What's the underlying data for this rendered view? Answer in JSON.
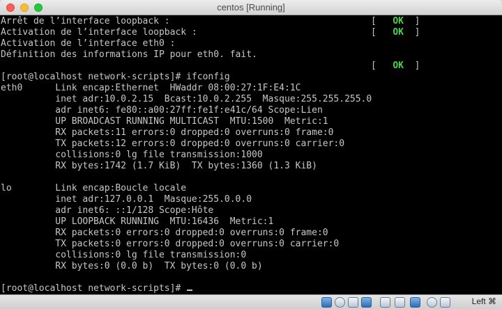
{
  "window": {
    "title": "centos [Running]"
  },
  "terminal": {
    "lines": [
      "Arrêt de l’interface loopback :",
      "Activation de l’interface loopback :",
      "Activation de l’interface eth0 :",
      "Définition des informations IP pour eth0. fait.",
      "",
      "[root@localhost network-scripts]# ifconfig",
      "eth0      Link encap:Ethernet  HWaddr 08:00:27:1F:E4:1C",
      "          inet adr:10.0.2.15  Bcast:10.0.2.255  Masque:255.255.255.0",
      "          adr inet6: fe80::a00:27ff:fe1f:e41c/64 Scope:Lien",
      "          UP BROADCAST RUNNING MULTICAST  MTU:1500  Metric:1",
      "          RX packets:11 errors:0 dropped:0 overruns:0 frame:0",
      "          TX packets:12 errors:0 dropped:0 overruns:0 carrier:0",
      "          collisions:0 lg file transmission:1000",
      "          RX bytes:1742 (1.7 KiB)  TX bytes:1360 (1.3 KiB)",
      "",
      "lo        Link encap:Boucle locale",
      "          inet adr:127.0.0.1  Masque:255.0.0.0",
      "          adr inet6: ::1/128 Scope:Hôte",
      "          UP LOOPBACK RUNNING  MTU:16436  Metric:1",
      "          RX packets:0 errors:0 dropped:0 overruns:0 frame:0",
      "          TX packets:0 errors:0 dropped:0 overruns:0 carrier:0",
      "          collisions:0 lg file transmission:0",
      "          RX bytes:0 (0.0 b)  TX bytes:0 (0.0 b)",
      "",
      "[root@localhost network-scripts]# "
    ],
    "status": [
      {
        "text": "OK"
      },
      {
        "text": "OK"
      },
      {
        "text": "OK"
      }
    ],
    "status_open": "[",
    "status_close": "]"
  },
  "statusbar": {
    "icons": [
      "hard-disk-icon",
      "optical-disk-icon",
      "usb-icon",
      "network-icon",
      "shared-folder-icon",
      "display-icon",
      "video-capture-icon",
      "virtualization-icon",
      "mouse-integration-icon",
      "arrow-down-icon"
    ],
    "hostkey": "Left ⌘"
  },
  "colors": {
    "ok": "#4fd24f",
    "text": "#c7c7c7",
    "background": "#000000"
  }
}
